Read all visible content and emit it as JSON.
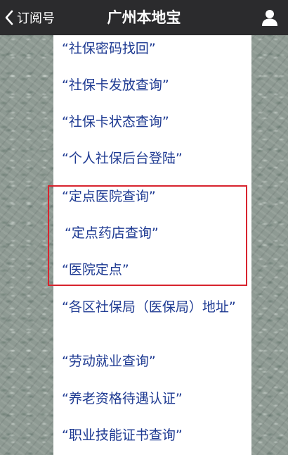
{
  "navbar": {
    "back_label": "订阅号",
    "title": "广州本地宝"
  },
  "items": [
    "“社保密码找回”",
    "“社保卡发放查询”",
    "“社保卡状态查询”",
    "“个人社保后台登陆”",
    "“定点医院查询”",
    "“定点药店查询”",
    "“医院定点”",
    "“各区社保局（医保局）地址”",
    "“劳动就业查询”",
    "“养老资格待遇认证”",
    "“职业技能证书查询”"
  ],
  "colors": {
    "navbar": "#2b2b2d",
    "link_text": "#1e3a92",
    "highlight": "#d8242e"
  }
}
